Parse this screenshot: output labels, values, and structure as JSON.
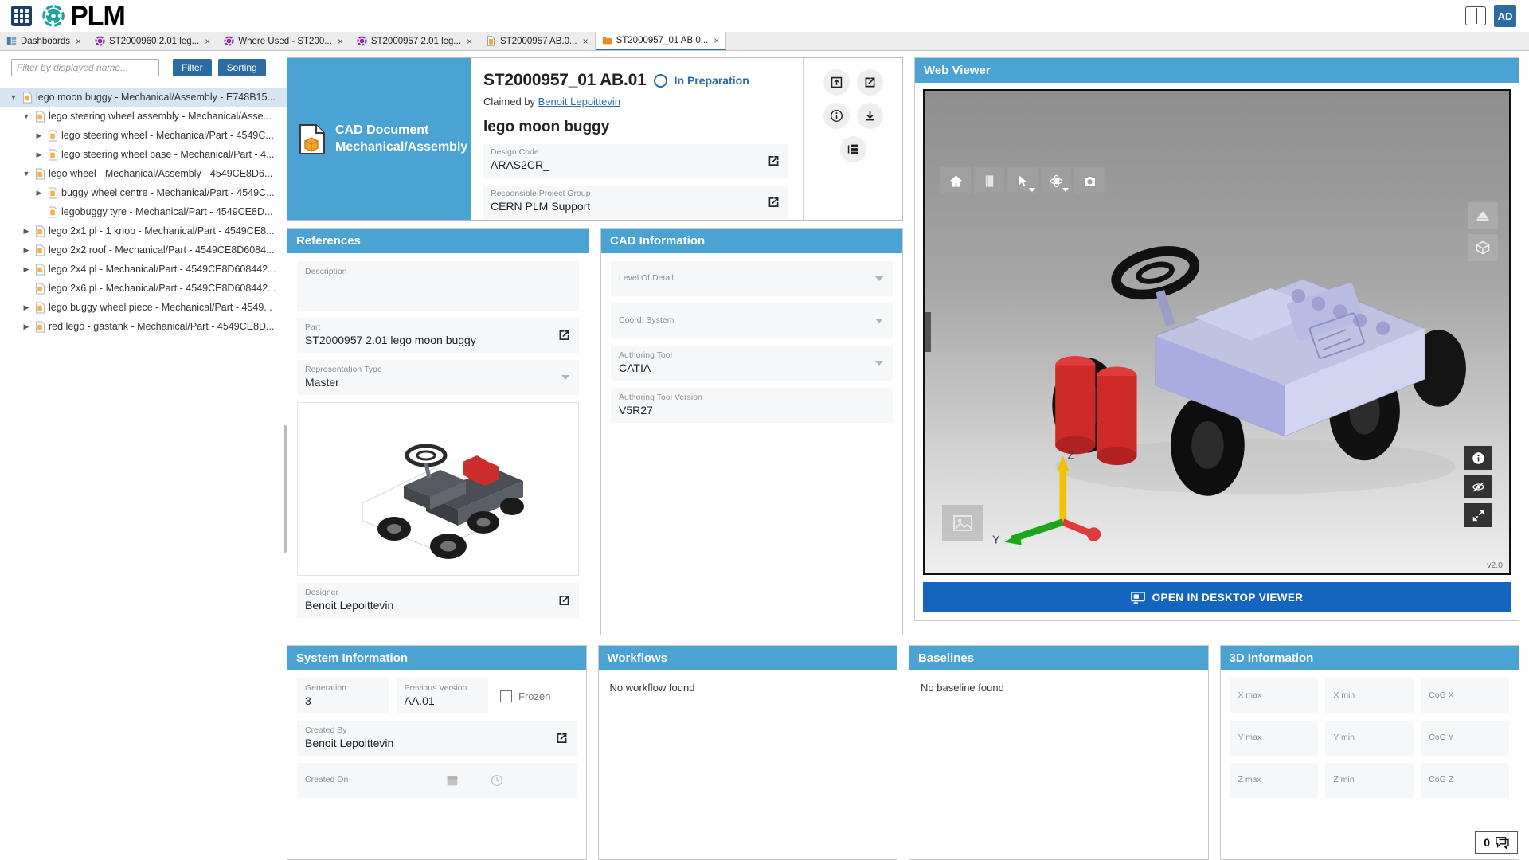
{
  "app": {
    "brand": "PLM",
    "avatar_initials": "AD",
    "waffle_icon": "grid-apps-icon",
    "panel_toggle_icon": "split-panel-icon"
  },
  "tabs": [
    {
      "label": "Dashboards",
      "icon": "dashboard-icon",
      "active": false,
      "close": "×"
    },
    {
      "label": "ST2000960 2.01 leg...",
      "icon": "gear-purple-icon",
      "active": false,
      "close": "×"
    },
    {
      "label": "Where Used - ST200...",
      "icon": "gear-purple-icon",
      "active": false,
      "close": "×"
    },
    {
      "label": "ST2000957 2.01 leg...",
      "icon": "gear-purple-icon",
      "active": false,
      "close": "×"
    },
    {
      "label": "ST2000957 AB.0...",
      "icon": "document-icon",
      "active": false,
      "close": "×"
    },
    {
      "label": "ST2000957_01 AB.0...",
      "icon": "folder-icon",
      "active": true,
      "close": "×"
    }
  ],
  "tree_toolbar": {
    "filter_placeholder": "Filter by displayed name...",
    "filter_value": "",
    "filter_button": "Filter",
    "sorting_button": "Sorting"
  },
  "tree": [
    {
      "label": "lego moon buggy - Mechanical/Assembly - E748B15...",
      "depth": 0,
      "twisty": "down",
      "selected": true
    },
    {
      "label": "lego steering wheel assembly - Mechanical/Asse...",
      "depth": 1,
      "twisty": "down",
      "selected": false
    },
    {
      "label": "lego steering wheel - Mechanical/Part - 4549C...",
      "depth": 2,
      "twisty": "right",
      "selected": false
    },
    {
      "label": "lego steering wheel base - Mechanical/Part - 4...",
      "depth": 2,
      "twisty": "right",
      "selected": false
    },
    {
      "label": "lego wheel - Mechanical/Assembly - 4549CE8D6...",
      "depth": 1,
      "twisty": "down",
      "selected": false
    },
    {
      "label": "buggy wheel centre - Mechanical/Part - 4549C...",
      "depth": 2,
      "twisty": "right",
      "selected": false
    },
    {
      "label": "legobuggy tyre - Mechanical/Part - 4549CE8D...",
      "depth": 2,
      "twisty": "none",
      "selected": false
    },
    {
      "label": "lego 2x1 pl - 1 knob - Mechanical/Part - 4549CE8...",
      "depth": 1,
      "twisty": "right",
      "selected": false
    },
    {
      "label": "lego 2x2 roof - Mechanical/Part - 4549CE8D6084...",
      "depth": 1,
      "twisty": "right",
      "selected": false
    },
    {
      "label": "lego 2x4 pl - Mechanical/Part - 4549CE8D608442...",
      "depth": 1,
      "twisty": "right",
      "selected": false
    },
    {
      "label": "lego 2x6 pl - Mechanical/Part - 4549CE8D608442...",
      "depth": 1,
      "twisty": "none",
      "selected": false
    },
    {
      "label": "lego buggy wheel piece - Mechanical/Part - 4549...",
      "depth": 1,
      "twisty": "right",
      "selected": false
    },
    {
      "label": "red lego - gastank - Mechanical/Part - 4549CE8D...",
      "depth": 1,
      "twisty": "right",
      "selected": false
    }
  ],
  "header_card": {
    "type_line1": "CAD Document",
    "type_line2": "Mechanical/Assembly",
    "type_icon": "cad-document-icon",
    "doc_number": "ST2000957_01 AB.01",
    "state": "In Preparation",
    "state_icon": "circle-state-icon",
    "claimed_prefix": "Claimed by",
    "claimed_by": "Benoit Lepoittevin",
    "doc_name": "lego moon buggy",
    "fields": [
      {
        "label": "Design Code",
        "value": "ARAS2CR_",
        "action_icon": "external-link-icon"
      },
      {
        "label": "Responsible Project Group",
        "value": "CERN PLM Support",
        "action_icon": "external-link-icon"
      }
    ],
    "buttons": [
      {
        "name": "check-in-icon"
      },
      {
        "name": "open-external-icon"
      },
      {
        "name": "info-icon"
      },
      {
        "name": "download-icon"
      },
      {
        "name": "structure-icon"
      }
    ]
  },
  "references": {
    "title": "References",
    "description_label": "Description",
    "description_value": "",
    "part_label": "Part",
    "part_value": "ST2000957 2.01 lego moon buggy",
    "part_action_icon": "external-link-icon",
    "representation_label": "Representation Type",
    "representation_value": "Master",
    "thumbnail_name": "lego-moon-buggy-thumbnail",
    "designer_label": "Designer",
    "designer_value": "Benoit Lepoittevin",
    "designer_action_icon": "external-link-icon"
  },
  "cad_information": {
    "title": "CAD Information",
    "fields": [
      {
        "label": "Level Of Detail",
        "value": "",
        "dropdown": true
      },
      {
        "label": "Coord. System",
        "value": "",
        "dropdown": true
      },
      {
        "label": "Authoring Tool",
        "value": "CATIA",
        "dropdown": true
      },
      {
        "label": "Authoring Tool Version",
        "value": "V5R27",
        "dropdown": false
      }
    ]
  },
  "web_viewer": {
    "title": "Web Viewer",
    "version": "v2.0",
    "open_desktop_label": "OPEN IN DESKTOP VIEWER",
    "open_desktop_icon": "desktop-viewer-icon",
    "toolbar_left": [
      {
        "name": "home-icon",
        "caret": false
      },
      {
        "name": "book-icon",
        "caret": false
      },
      {
        "name": "cursor-select-icon",
        "caret": true
      },
      {
        "name": "rotate-icon",
        "caret": true
      },
      {
        "name": "camera-icon",
        "caret": false
      }
    ],
    "toolbar_right": [
      {
        "name": "section-plane-icon"
      },
      {
        "name": "box-model-icon"
      }
    ],
    "toolbar_bottom_right": [
      {
        "name": "info-icon"
      },
      {
        "name": "hide-eye-icon"
      },
      {
        "name": "fit-expand-icon"
      }
    ],
    "image_button": "image-placeholder-icon",
    "side_handle": "»",
    "axis": {
      "z": "Z",
      "y": "Y"
    }
  },
  "system_information": {
    "title": "System Information",
    "generation_label": "Generation",
    "generation_value": "3",
    "previous_version_label": "Previous Version",
    "previous_version_value": "AA.01",
    "frozen_label": "Frozen",
    "frozen_checked": false,
    "created_by_label": "Created By",
    "created_by_value": "Benoit Lepoittevin",
    "created_by_action_icon": "external-link-icon",
    "created_on_label": "Created On",
    "created_on_value": "",
    "calendar_icon": "calendar-icon",
    "clock_icon": "clock-icon"
  },
  "workflows": {
    "title": "Workflows",
    "empty": "No workflow found"
  },
  "baselines": {
    "title": "Baselines",
    "empty": "No baseline found"
  },
  "three_d_information": {
    "title": "3D Information",
    "fields": [
      {
        "label": "X max"
      },
      {
        "label": "X min"
      },
      {
        "label": "CoG X"
      },
      {
        "label": "Y max"
      },
      {
        "label": "Y min"
      },
      {
        "label": "CoG Y"
      },
      {
        "label": "Z max"
      },
      {
        "label": "Z min"
      },
      {
        "label": "CoG Z"
      }
    ]
  },
  "chat": {
    "count": "0",
    "icon": "chat-bubble-icon"
  },
  "colors": {
    "accent_blue": "#4ba3d3",
    "brand_teal": "#17a398",
    "button_blue": "#2d6ca2",
    "primary_button": "#1565c0"
  }
}
